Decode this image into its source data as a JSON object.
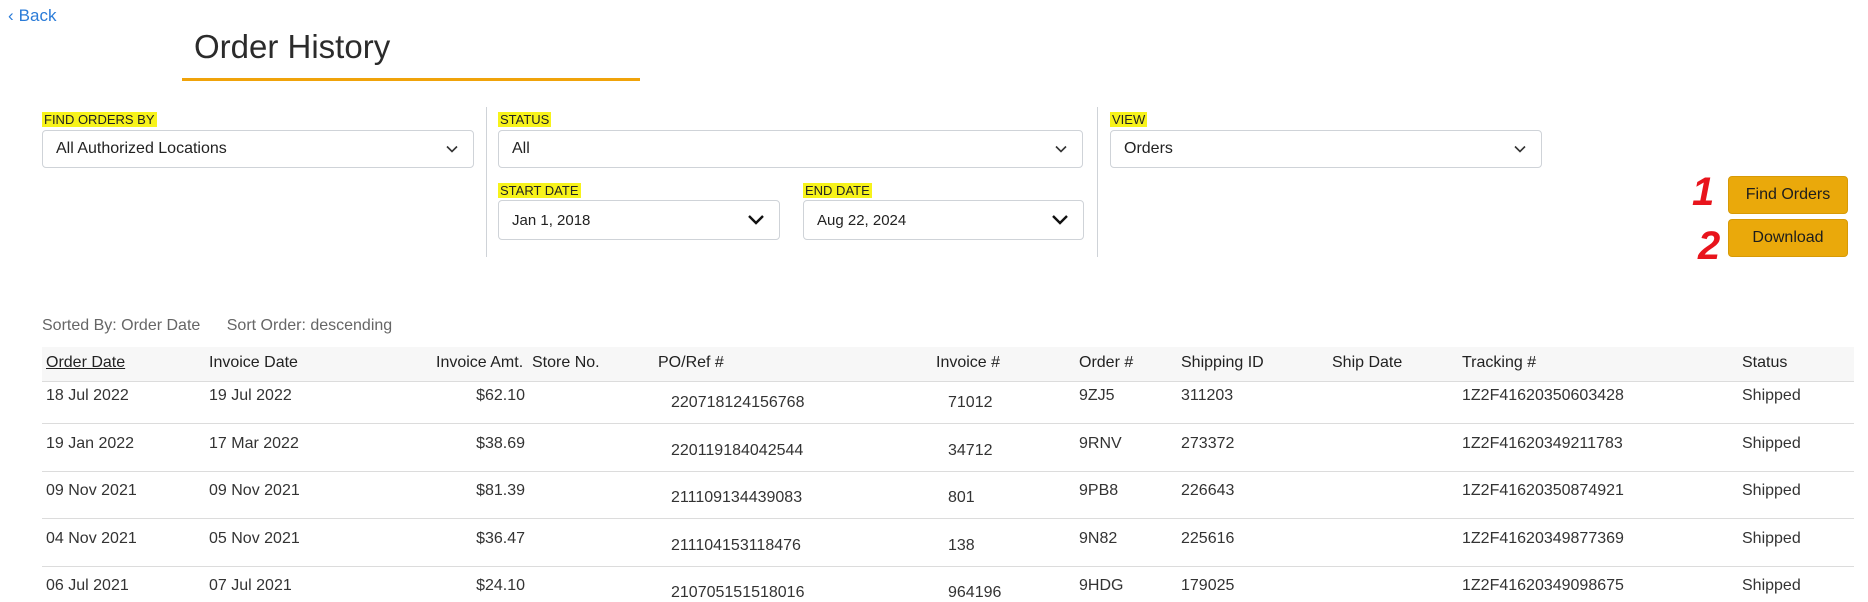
{
  "nav": {
    "back_label": "Back"
  },
  "page": {
    "title": "Order History"
  },
  "filters": {
    "find_by": {
      "label": "FIND ORDERS BY",
      "value": "All Authorized Locations"
    },
    "status": {
      "label": "STATUS",
      "value": "All"
    },
    "view": {
      "label": "VIEW",
      "value": "Orders"
    },
    "start_date": {
      "label": "START DATE",
      "value": "Jan 1, 2018"
    },
    "end_date": {
      "label": "END DATE",
      "value": "Aug 22, 2024"
    }
  },
  "actions": {
    "find_orders_label": "Find Orders",
    "download_label": "Download",
    "annotation_1": "1",
    "annotation_2": "2"
  },
  "sort": {
    "sorted_by": "Sorted By: Order Date",
    "sort_order": "Sort Order: descending"
  },
  "table": {
    "columns": [
      "Order Date",
      "Invoice Date",
      "Invoice Amt.",
      "Store No.",
      "PO/Ref #",
      "Invoice #",
      "Order #",
      "Shipping ID",
      "Ship Date",
      "Tracking #",
      "Status"
    ],
    "rows": [
      {
        "order_date": "18 Jul 2022",
        "invoice_date": "19 Jul 2022",
        "amount": "$62.10",
        "store": "",
        "po": "220718124156768",
        "invoice": "71012",
        "order": "9ZJ5",
        "shipping_id": "311203",
        "ship_date": "",
        "tracking": "1Z2F41620350603428",
        "status": "Shipped"
      },
      {
        "order_date": "19 Jan 2022",
        "invoice_date": "17 Mar 2022",
        "amount": "$38.69",
        "store": "",
        "po": "220119184042544",
        "invoice": "34712",
        "order": "9RNV",
        "shipping_id": "273372",
        "ship_date": "",
        "tracking": "1Z2F41620349211783",
        "status": "Shipped"
      },
      {
        "order_date": "09 Nov 2021",
        "invoice_date": "09 Nov 2021",
        "amount": "$81.39",
        "store": "",
        "po": "211109134439083",
        "invoice": "801",
        "order": "9PB8",
        "shipping_id": "226643",
        "ship_date": "",
        "tracking": "1Z2F41620350874921",
        "status": "Shipped"
      },
      {
        "order_date": "04 Nov 2021",
        "invoice_date": "05 Nov 2021",
        "amount": "$36.47",
        "store": "",
        "po": "211104153118476",
        "invoice": "138",
        "order": "9N82",
        "shipping_id": "225616",
        "ship_date": "",
        "tracking": "1Z2F41620349877369",
        "status": "Shipped"
      },
      {
        "order_date": "06 Jul 2021",
        "invoice_date": "07 Jul 2021",
        "amount": "$24.10",
        "store": "",
        "po": "210705151518016",
        "invoice": "964196",
        "order": "9HDG",
        "shipping_id": "179025",
        "ship_date": "",
        "tracking": "1Z2F41620349098675",
        "status": "Shipped"
      }
    ]
  },
  "colors": {
    "accent": "#eaa90b",
    "link": "#2a7bd8",
    "highlight": "#f7f31b",
    "annotation": "#e8141c"
  }
}
